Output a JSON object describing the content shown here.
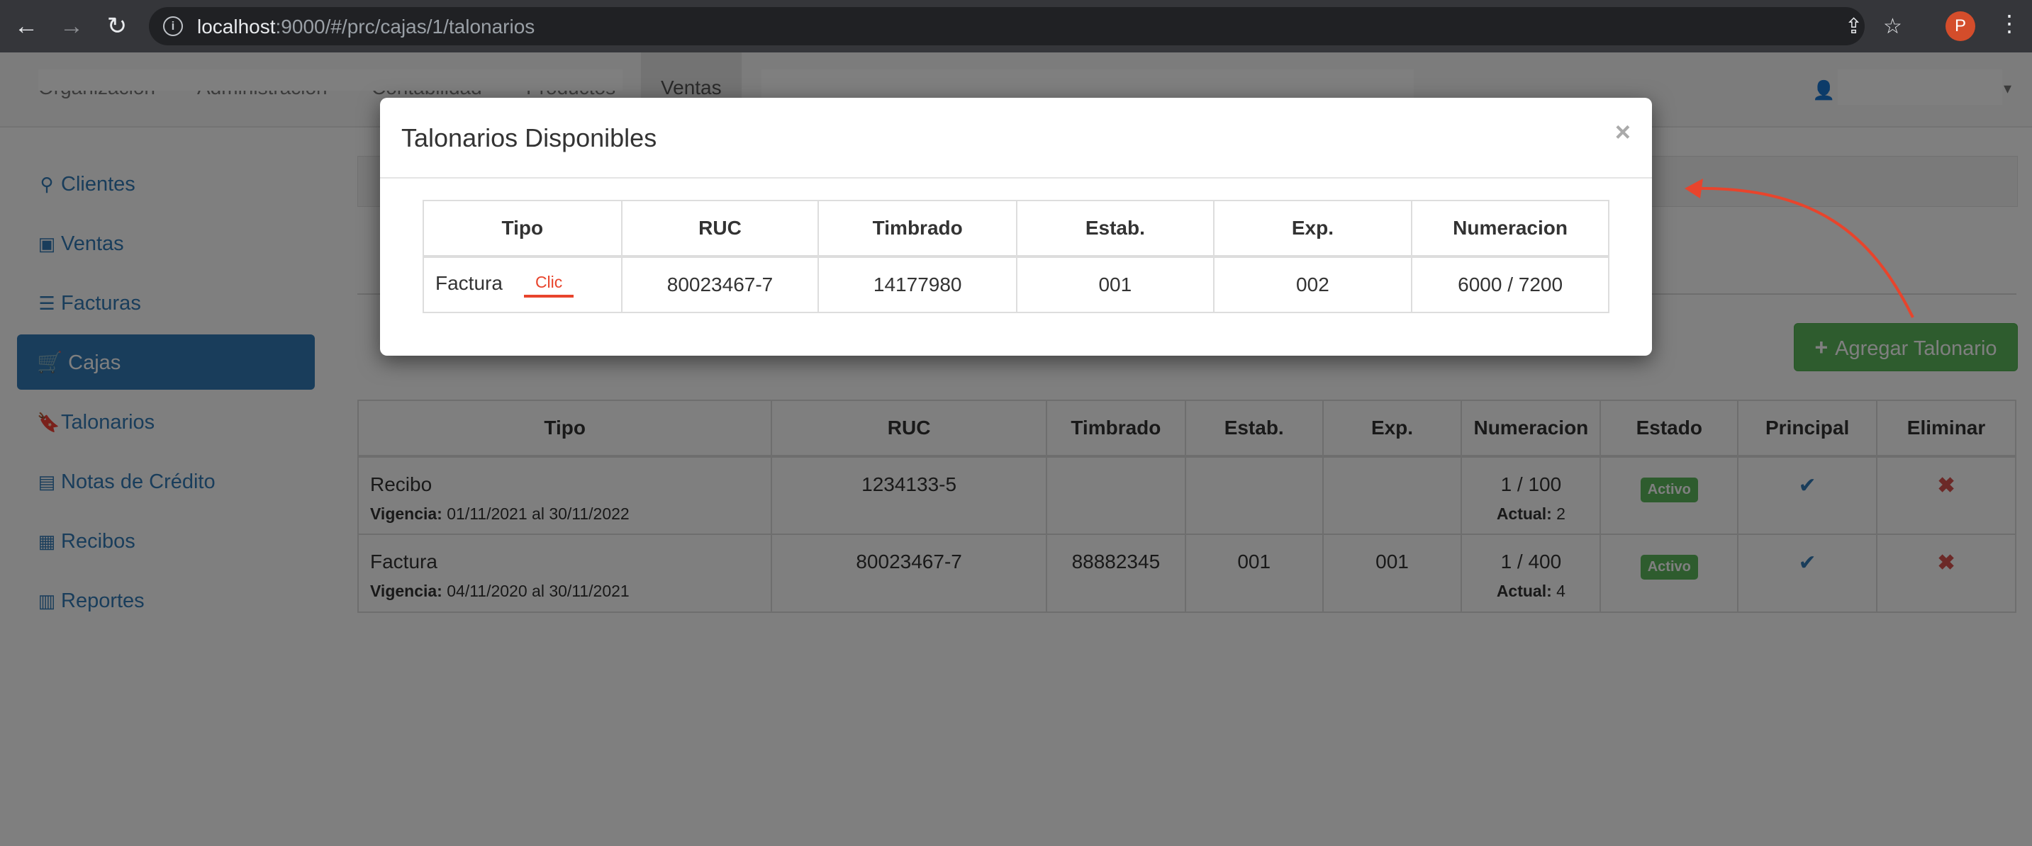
{
  "browser": {
    "url_host": "localhost",
    "url_rest": ":9000/#/prc/cajas/1/talonarios",
    "profile_initial": "P",
    "icons": [
      "back-icon",
      "forward-icon",
      "reload-icon",
      "info-icon",
      "share-icon",
      "star-icon",
      "menu-kebab-icon"
    ]
  },
  "navbar": {
    "items": [
      "Organización",
      "Administración",
      "Contabilidad",
      "Productos"
    ],
    "active": "Ventas"
  },
  "sidebar": {
    "items": [
      {
        "icon": "user-icon",
        "label": "Clientes"
      },
      {
        "icon": "money-icon",
        "label": "Ventas"
      },
      {
        "icon": "list-icon",
        "label": "Facturas"
      },
      {
        "icon": "cart-icon",
        "label": "Cajas",
        "active": true
      },
      {
        "icon": "bookmark-icon",
        "label": "Talonarios"
      },
      {
        "icon": "note-icon",
        "label": "Notas de Crédito"
      },
      {
        "icon": "receipt-icon",
        "label": "Recibos"
      },
      {
        "icon": "report-icon",
        "label": "Reportes"
      }
    ]
  },
  "page": {
    "add_button": "Agregar Talonario",
    "table": {
      "headers": [
        "Tipo",
        "RUC",
        "Timbrado",
        "Estab.",
        "Exp.",
        "Numeracion",
        "Estado",
        "Principal",
        "Eliminar"
      ],
      "vigencia_label": "Vigencia:",
      "actual_label": "Actual:",
      "rows": [
        {
          "tipo": "Recibo",
          "vigencia": "01/11/2021 al 30/11/2022",
          "ruc": "1234133-5",
          "timbrado": "",
          "estab": "",
          "exp": "",
          "numeracion": "1 / 100",
          "actual": "2",
          "estado": "Activo"
        },
        {
          "tipo": "Factura",
          "vigencia": "04/11/2020 al 30/11/2021",
          "ruc": "80023467-7",
          "timbrado": "88882345",
          "estab": "001",
          "exp": "001",
          "numeracion": "1 / 400",
          "actual": "4",
          "estado": "Activo"
        }
      ]
    }
  },
  "modal": {
    "title": "Talonarios Disponibles",
    "close": "×",
    "headers": [
      "Tipo",
      "RUC",
      "Timbrado",
      "Estab.",
      "Exp.",
      "Numeracion"
    ],
    "rows": [
      {
        "tipo": "Factura",
        "ruc": "80023467-7",
        "timbrado": "14177980",
        "estab": "001",
        "exp": "002",
        "numeracion": "6000 / 7200"
      }
    ],
    "annotation": "Clic"
  },
  "colors": {
    "primary": "#337ab7",
    "success": "#5cb85c",
    "danger": "#d9534f",
    "annotation": "#e8442c"
  }
}
